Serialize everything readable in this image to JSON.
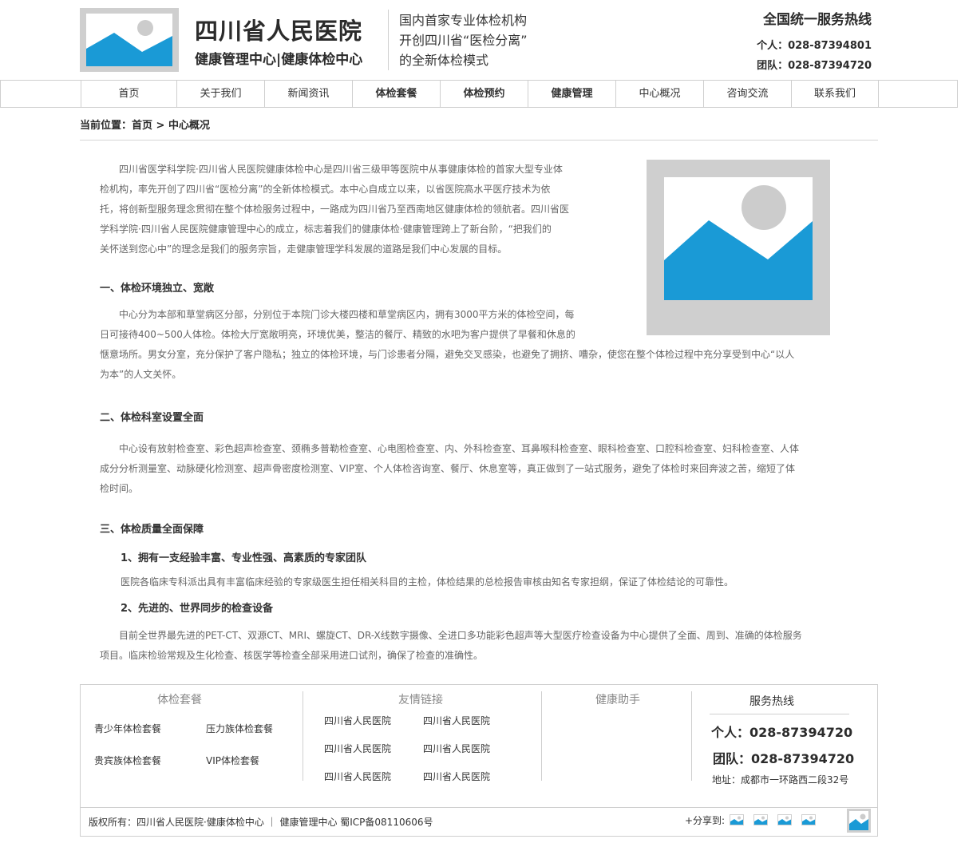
{
  "header": {
    "site_title": "四川省人民医院",
    "site_subtitle": "健康管理中心|健康体检中心",
    "slogan_lines": [
      "国内首家专业体检机构",
      "开创四川省“医检分离”",
      "的全新体检模式"
    ],
    "hotline_title": "全国统一服务热线",
    "hotline_personal": "个人：028-87394801",
    "hotline_team": "团队：028-87394720"
  },
  "nav": {
    "items": [
      {
        "label": "首页"
      },
      {
        "label": "关于我们"
      },
      {
        "label": "新闻资讯"
      },
      {
        "label": "体检套餐"
      },
      {
        "label": "体检预约"
      },
      {
        "label": "健康管理"
      },
      {
        "label": "中心概况"
      },
      {
        "label": "咨询交流"
      },
      {
        "label": "联系我们"
      }
    ]
  },
  "breadcrumb": "当前位置：首页 > 中心概况",
  "content": {
    "intro_lines": [
      "四川省医学科学院·四川省人民医院健康体检中心是四川省三级甲等医院中从事健康体检的首家大型专业体",
      "检机构，率先开创了四川省“医检分离”的全新体检模式。本中心自成立以来，以省医院高水平医疗技术为依",
      "托，将创新型服务理念贯彻在整个体检服务过程中，一路成为四川省乃至西南地区健康体检的领航者。四川省医",
      "学科学院·四川省人民医院健康管理中心的成立，标志着我们的健康体检·健康管理跨上了新台阶，“把我们的",
      "关怀送到您心中”的理念是我们的服务宗旨，走健康管理学科发展的道路是我们中心发展的目标。"
    ],
    "s1_title": "一、体检环境独立、宽敞",
    "s1_lines": [
      "中心分为本部和草堂病区分部，分别位于本院门诊大楼四楼和草堂病区内，拥有3000平方米的体检空间，每",
      "日可接待400~500人体检。体检大厅宽敞明亮，环境优美，整洁的餐厅、精致的水吧为客户提供了早餐和休息的",
      "惬意场所。男女分室，充分保护了客户隐私；独立的体检环境，与门诊患者分隔，避免交叉感染，也避免了拥挤、嘈杂，使您在整个体检过程中充分享受到中心“以人",
      "为本”的人文关怀。"
    ],
    "s2_title": "二、体检科室设置全面",
    "s2_lines": [
      "中心设有放射检查室、彩色超声检查室、颈椭多普勒检查室、心电图检查室、内、外科检查室、耳鼻喉科检查室、眼科检查室、口腔科检查室、妇科检查室、人体",
      "成分分析测量室、动脉硬化检测室、超声骨密度检测室、VIP室、个人体检咨询室、餐厅、休息室等，真正做到了一站式服务，避免了体检时来回奔波之苦，缩短了体",
      "检时间。"
    ],
    "s3_title": "三、体检质量全面保障",
    "s3_1_title": "1、拥有一支经验丰富、专业性强、高素质的专家团队",
    "s3_1_text": "医院各临床专科派出具有丰富临床经验的专家级医生担任相关科目的主检，体检结果的总检报告审核由知名专家担纲，保证了体检结论的可靠性。",
    "s3_2_title": "2、先进的、世界同步的检查设备",
    "s3_2_lines": [
      "目前全世界最先进的PET-CT、双源CT、MRI、螺旋CT、DR-X线数字摄像、全进口多功能彩色超声等大型医疗检查设备为中心提供了全面、周到、准确的体检服务",
      "项目。临床检验常规及生化检查、核医学等检查全部采用进口试剂，确保了检查的准确性。"
    ]
  },
  "footer": {
    "packages_title": "体检套餐",
    "packages": [
      "青少年体检套餐",
      "压力族体检套餐",
      "贵宾族体检套餐",
      "VIP体检套餐"
    ],
    "links_title": "友情链接",
    "links": [
      "四川省人民医院",
      "四川省人民医院",
      "四川省人民医院",
      "四川省人民医院",
      "四川省人民医院",
      "四川省人民医院"
    ],
    "assistant_title": "健康助手",
    "hotline_title": "服务热线",
    "hotline_personal": "个人：028-87394720",
    "hotline_team": "团队：028-87394720",
    "address": "地址：成都市一环路西二段32号",
    "copyright": "版权所有：四川省人民医院·健康体检中心 ｜ 健康管理中心   蜀ICP备08110606号",
    "share_label": "+分享到:"
  },
  "colors": {
    "placeholder_bg": "#cfcfcf",
    "placeholder_blue": "#1a9ad6",
    "placeholder_circle": "#cccccc"
  }
}
